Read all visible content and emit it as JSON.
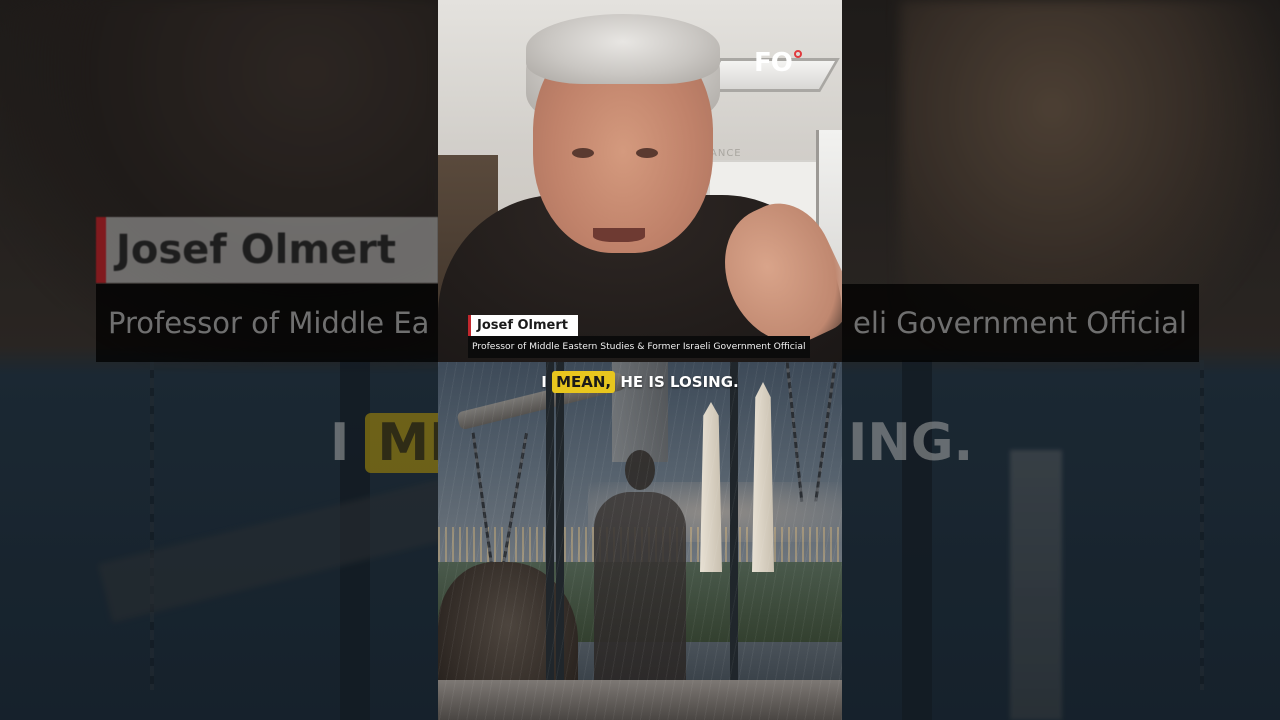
{
  "lower_third": {
    "name": "Josef Olmert",
    "title": "Professor of Middle Eastern Studies & Former Israeli Government Official"
  },
  "caption": {
    "prefix": "I",
    "highlight": "MEAN,",
    "rest": "HE IS LOSING."
  },
  "background_text": {
    "name_fragment": "Josef Olmert",
    "title_left_fragment": "Professor of Middle Ea",
    "title_right_fragment": "eli Government Official",
    "caption_left_prefix": "I",
    "caption_left_highlight": "ME",
    "caption_right_fragment": "ING."
  },
  "scene": {
    "wall_text": "ANCE"
  },
  "logo": {
    "text": "FO"
  },
  "colors": {
    "accent_red": "#c1272d",
    "caption_highlight": "#e8c61e",
    "lower_third_bg": "#0b0b0b"
  }
}
